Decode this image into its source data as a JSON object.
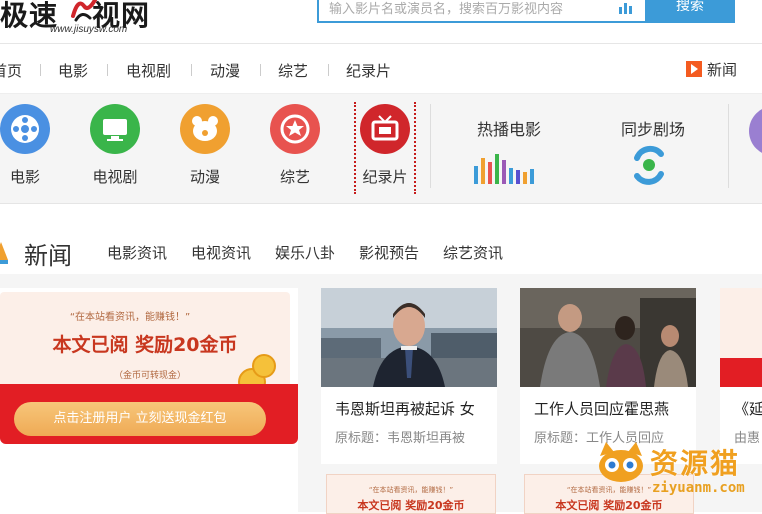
{
  "header": {
    "logo_text": "极速",
    "logo_text2": "视网",
    "logo_url": "www.jisuysw.com",
    "search_placeholder": "输入影片名或演员名，搜索百万影视内容",
    "search_button": "搜索"
  },
  "nav": {
    "items": [
      "首页",
      "电影",
      "电视剧",
      "动漫",
      "综艺",
      "纪录片"
    ],
    "news_label": "新闻"
  },
  "categories": {
    "items": [
      {
        "label": "电影",
        "color": "#4a90e2"
      },
      {
        "label": "电视剧",
        "color": "#3ab54a"
      },
      {
        "label": "动漫",
        "color": "#f0a030"
      },
      {
        "label": "综艺",
        "color": "#e8534f"
      },
      {
        "label": "纪录片",
        "color": "#d0262b"
      }
    ],
    "hot_movies": "热播电影",
    "sync_theater": "同步剧场"
  },
  "news": {
    "title": "新闻",
    "tabs": [
      "电影资讯",
      "电视资讯",
      "娱乐八卦",
      "影视预告",
      "综艺资讯"
    ]
  },
  "promo": {
    "small_text": "“在本站看资讯，能赚钱！”",
    "big_text": "本文已阅  奖励20金币",
    "note": "（金币可转现金）",
    "button": "点击注册用户 立刻送现金红包"
  },
  "cards": [
    {
      "title": "韦恩斯坦再被起诉 女",
      "subtitle": "原标题：韦恩斯坦再被"
    },
    {
      "title": "工作人员回应霍思燕",
      "subtitle": "原标题：工作人员回应"
    },
    {
      "title": "《延",
      "subtitle": "由惠"
    }
  ],
  "bottom_cards": [
    {
      "small": "“在本站看资讯，能赚钱！”",
      "big": "本文已阅  奖励20金币"
    },
    {
      "small": "“在本站看资讯，能赚钱！”",
      "big": "本文已阅  奖励20金币"
    }
  ],
  "watermark": {
    "text": "资源猫",
    "url": "ziyuanm.com"
  }
}
